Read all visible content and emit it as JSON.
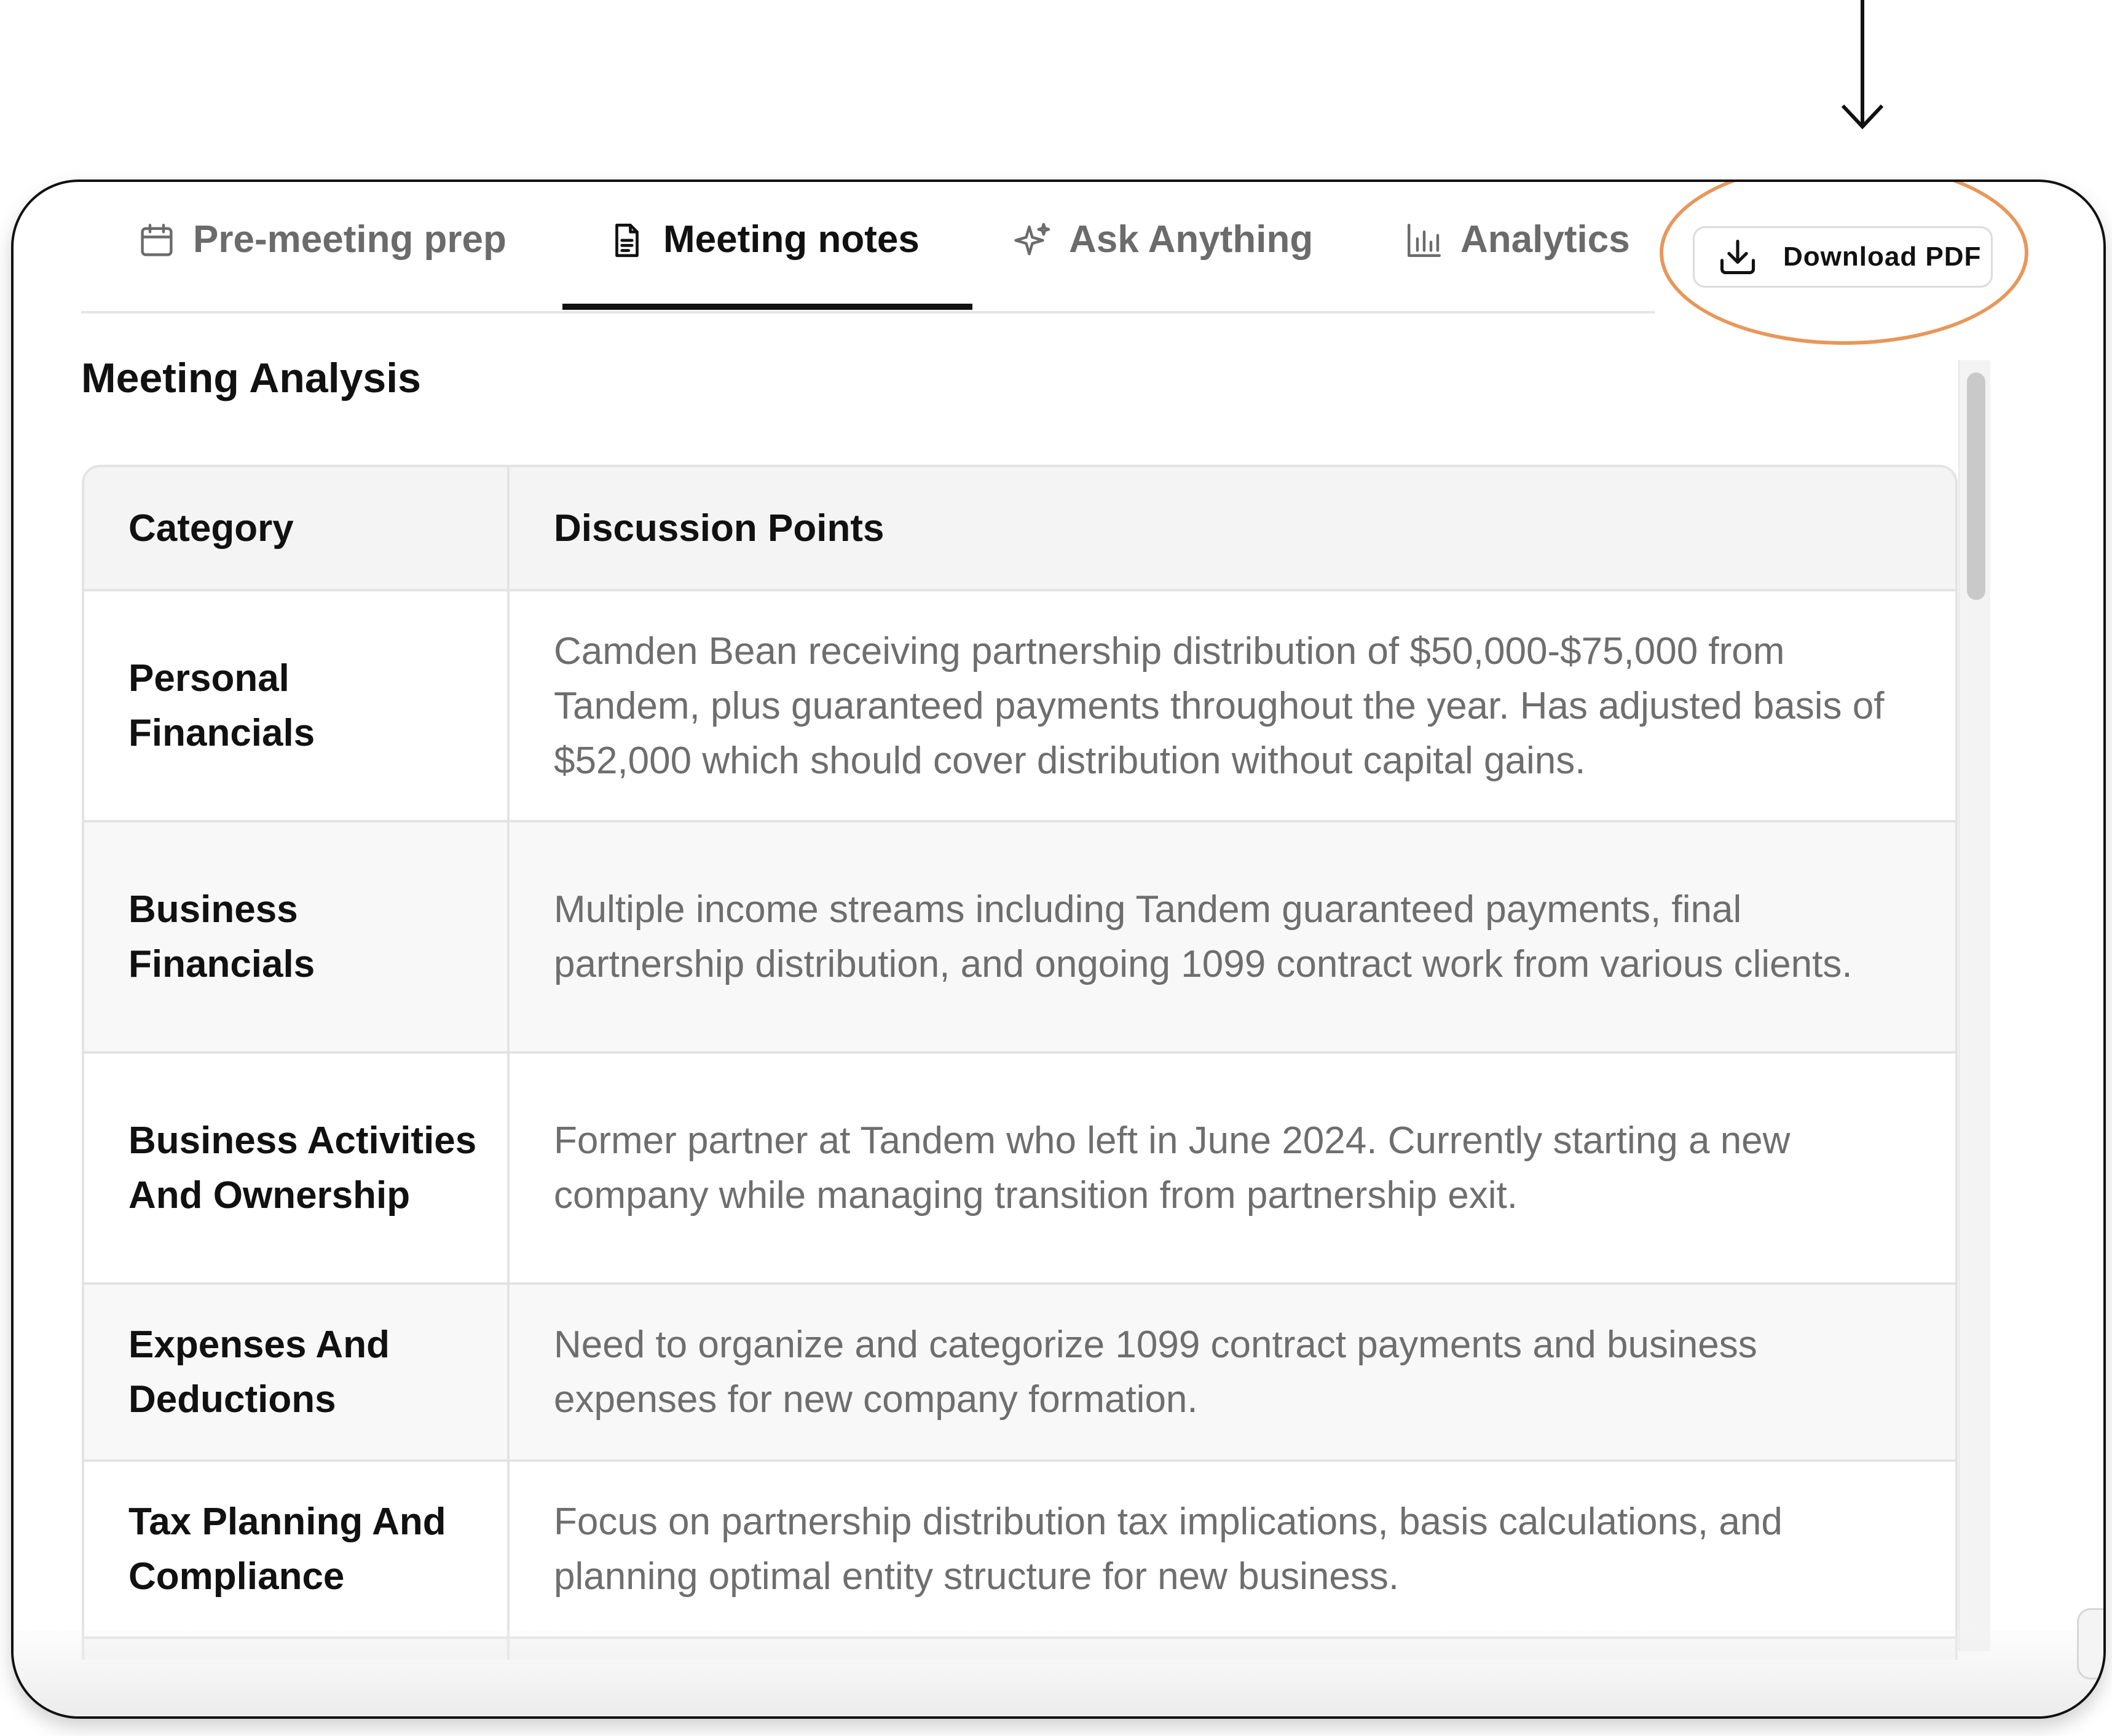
{
  "tabs": [
    {
      "label": "Pre-meeting prep",
      "icon": "calendar-icon",
      "active": false
    },
    {
      "label": "Meeting notes",
      "icon": "document-icon",
      "active": true
    },
    {
      "label": "Ask Anything",
      "icon": "sparkle-icon",
      "active": false
    },
    {
      "label": "Analytics",
      "icon": "bar-chart-icon",
      "active": false
    }
  ],
  "download_button": {
    "label": "Download PDF",
    "icon": "download-icon"
  },
  "section_title": "Meeting Analysis",
  "table": {
    "headers": [
      "Category",
      "Discussion Points"
    ],
    "rows": [
      {
        "category": "Personal Financials",
        "points": "Camden Bean receiving partnership distribution of $50,000-$75,000 from Tandem, plus guaranteed payments throughout the year. Has adjusted basis of $52,000 which should cover distribution without capital gains."
      },
      {
        "category": "Business Financials",
        "points": "Multiple income streams including Tandem guaranteed payments, final partnership distribution, and ongoing 1099 contract work from various clients."
      },
      {
        "category": "Business Activities And Ownership",
        "points": "Former partner at Tandem who left in June 2024. Currently starting a new company while managing transition from partnership exit."
      },
      {
        "category": "Expenses And Deductions",
        "points": "Need to organize and categorize 1099 contract payments and business expenses for new company formation."
      },
      {
        "category": "Tax Planning And Compliance",
        "points": "Focus on partnership distribution tax implications, basis calculations, and planning optimal entity structure for new business."
      }
    ]
  },
  "colors": {
    "highlight": "#e8975b",
    "text_primary": "#111111",
    "text_muted": "#6e6e6e",
    "border": "#e3e3e3"
  }
}
